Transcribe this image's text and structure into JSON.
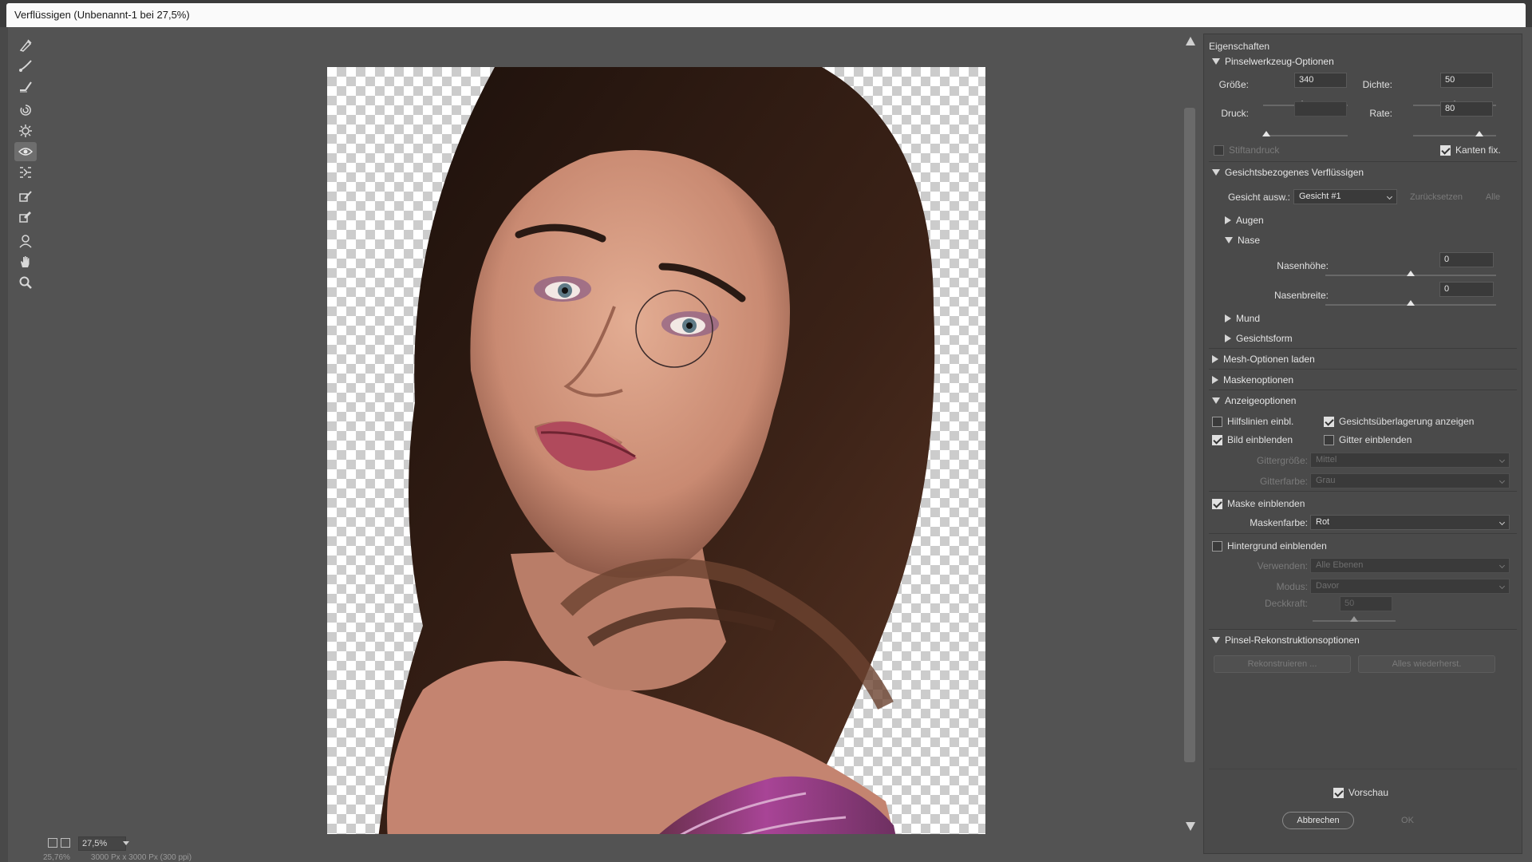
{
  "window": {
    "title": "Verflüssigen (Unbenannt-1 bei 27,5%)"
  },
  "tools": [
    {
      "name": "forward-warp-tool-icon"
    },
    {
      "name": "reconstruct-tool-icon"
    },
    {
      "name": "smooth-tool-icon"
    },
    {
      "name": "twirl-tool-icon"
    },
    {
      "name": "pucker-tool-icon"
    },
    {
      "name": "bloat-tool-icon"
    },
    {
      "name": "push-left-tool-icon"
    },
    {
      "name": "freeze-mask-tool-icon"
    },
    {
      "name": "thaw-mask-tool-icon"
    },
    {
      "name": "face-tool-icon"
    },
    {
      "name": "hand-tool-icon"
    },
    {
      "name": "zoom-tool-icon"
    }
  ],
  "status": {
    "zoom": "27,5%",
    "zoom_readout": "25,76%",
    "doc_size": "3000 Px x 3000 Px (300 ppi)"
  },
  "panel": {
    "title": "Eigenschaften",
    "brush": {
      "title": "Pinselwerkzeug-Optionen",
      "size_label": "Größe:",
      "size_value": "340",
      "size_level": 0.46,
      "density_label": "Dichte:",
      "density_value": "50",
      "density_level": 0.5,
      "pressure_label": "Druck:",
      "pressure_value": "",
      "pressure_level": 0.04,
      "rate_label": "Rate:",
      "rate_value": "80",
      "rate_level": 0.8,
      "stylus_label": "Stiftandruck",
      "pin_edges_label": "Kanten fix."
    },
    "face": {
      "title": "Gesichtsbezogenes Verflüssigen",
      "select_label": "Gesicht ausw.:",
      "select_value": "Gesicht #1",
      "reset_label": "Zurücksetzen",
      "all_label": "Alle",
      "eyes_label": "Augen",
      "nose_label": "Nase",
      "nose_height_label": "Nasenhöhe:",
      "nose_height_value": "0",
      "nose_height_level": 0.5,
      "nose_width_label": "Nasenbreite:",
      "nose_width_value": "0",
      "nose_width_level": 0.5,
      "mouth_label": "Mund",
      "face_shape_label": "Gesichtsform"
    },
    "mesh_label": "Mesh-Optionen laden",
    "mask_label": "Maskenoptionen",
    "view": {
      "title": "Anzeigeoptionen",
      "guides_label": "Hilfslinien einbl.",
      "face_overlay_label": "Gesichtsüberlagerung anzeigen",
      "image_label": "Bild einblenden",
      "mesh_label": "Gitter einblenden",
      "mesh_size_label": "Gittergröße:",
      "mesh_size_value": "Mittel",
      "mesh_color_label": "Gitterfarbe:",
      "mesh_color_value": "Grau",
      "show_mask_label": "Maske einblenden",
      "mask_color_label": "Maskenfarbe:",
      "mask_color_value": "Rot",
      "backdrop_label": "Hintergrund einblenden",
      "use_label": "Verwenden:",
      "use_value": "Alle Ebenen",
      "mode_label": "Modus:",
      "mode_value": "Davor",
      "opacity_label": "Deckkraft:",
      "opacity_value": "50",
      "opacity_level": 0.5
    },
    "reconstruct": {
      "title": "Pinsel-Rekonstruktionsoptionen",
      "reconstruct_label": "Rekonstruieren ...",
      "restore_all_label": "Alles wiederherst."
    },
    "preview_label": "Vorschau",
    "cancel_label": "Abbrechen",
    "ok_label": "OK"
  },
  "colors": {
    "accent_skin": "#d79d84",
    "hair": "#2f1a12",
    "lip": "#b04a5c",
    "scarf": "#9b3f8d"
  }
}
